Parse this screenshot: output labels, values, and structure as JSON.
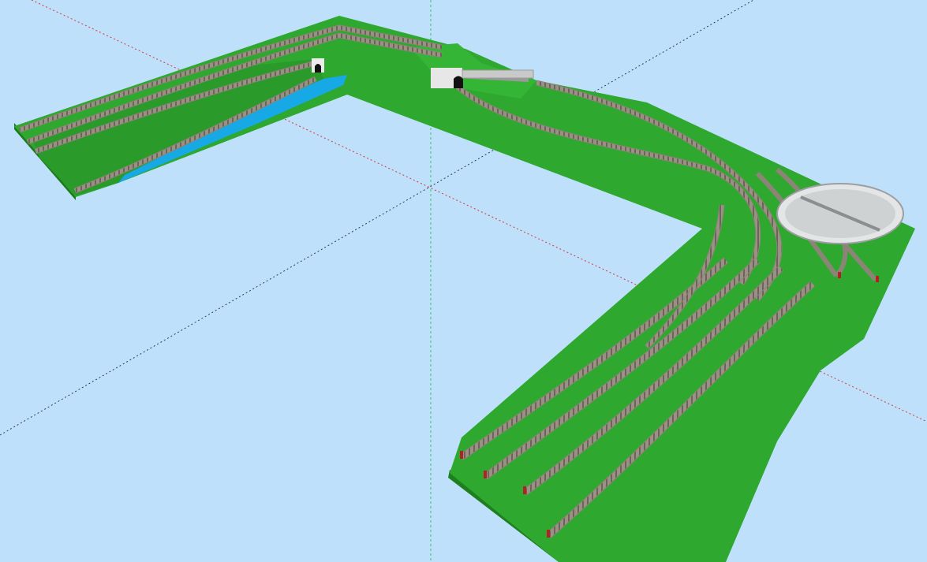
{
  "scene": {
    "type": "3d-model-railway-layout-viewport",
    "colors": {
      "sky": "#bfe0fb",
      "grass": "#2ea82e",
      "grass_dark": "#1f7f1f",
      "board_edge": "#2a8a2a",
      "water": "#16a9e6",
      "track": "#8c8476",
      "ballast": "#a59a8c",
      "turntable": "#cfd2d3",
      "axis_red": "#d23a3a",
      "axis_green": "#35c86a",
      "axis_dark": "#2a3e5a"
    },
    "objects": [
      "left-wing-board",
      "corner-board",
      "yard-board",
      "river",
      "tunnel-portal-left",
      "tunnel-portal-center",
      "bridge",
      "turntable",
      "yard-tracks",
      "mainline-tracks"
    ]
  }
}
